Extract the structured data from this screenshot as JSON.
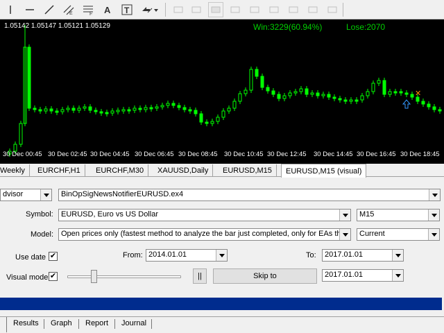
{
  "chart": {
    "ohlc_text": "1.05142 1.05147 1.05121 1.05129",
    "win_text": "Win:3229(60.94%)",
    "lose_text": "Lose:2070",
    "time_labels": [
      "30 Dec 00:45",
      "30 Dec 02:45",
      "30 Dec 04:45",
      "30 Dec 06:45",
      "30 Dec 08:45",
      "30 Dec 10:45",
      "30 Dec 12:45",
      "30 Dec 14:45",
      "30 Dec 16:45",
      "30 Dec 18:45"
    ],
    "colors": {
      "background": "#000000",
      "candle": "#00ff00",
      "text": "#ffffff",
      "stats": "#00d000",
      "sell_signal": "#ff8c00",
      "buy_signal": "#3399ff"
    }
  },
  "chart_tabs": [
    {
      "label": "Weekly",
      "active": false
    },
    {
      "label": "EURCHF,H1",
      "active": false
    },
    {
      "label": "EURCHF,M30",
      "active": false
    },
    {
      "label": "XAUUSD,Daily",
      "active": false
    },
    {
      "label": "EURUSD,M15",
      "active": false
    },
    {
      "label": "EURUSD,M15 (visual)",
      "active": true
    }
  ],
  "tester": {
    "expert_type_value": "dvisor",
    "expert_file_value": "BinOpSigNewsNotifierEURUSD.ex4",
    "symbol_label": "Symbol:",
    "symbol_value": "EURUSD, Euro vs US Dollar",
    "period_value": "M15",
    "model_label": "Model:",
    "model_value": "Open prices only (fastest method to analyze the bar just completed, only for EAs that e",
    "spread_value": "Current",
    "use_date_label": "Use date",
    "use_date_checked": "✔",
    "from_label": "From:",
    "from_value": "2014.01.01",
    "to_label": "To:",
    "to_value": "2017.01.01",
    "visual_mode_label": "Visual mode",
    "visual_mode_checked": "✔",
    "pause_label": "||",
    "skip_label": "Skip to",
    "skip_to_value": "2017.01.01",
    "progress_color": "#002c8e"
  },
  "bottom_tabs": [
    "Results",
    "Graph",
    "Report",
    "Journal"
  ]
}
